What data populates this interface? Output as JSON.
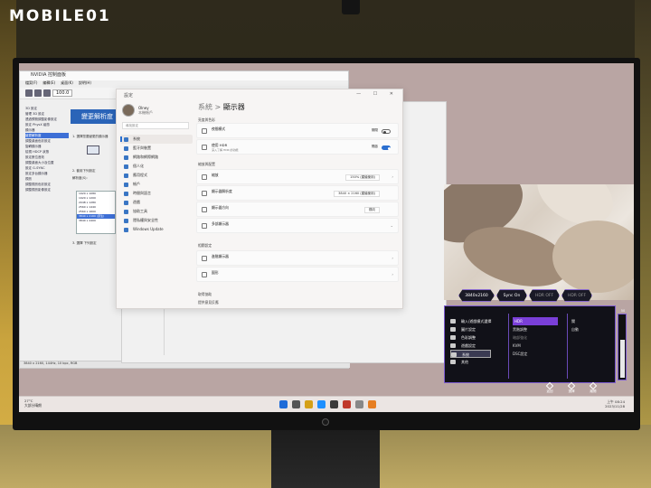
{
  "brand": {
    "text": "MOBILE01"
  },
  "old_window": {
    "title": "NVIDIA 控制面板",
    "menus": [
      "檔案(F)",
      "編輯(E)",
      "桌面(K)",
      "說明(H)"
    ],
    "zoom": "100.0",
    "panel_title": "變更解析度",
    "tree_items": [
      "3D 設定",
      "管理 3D 設定",
      "透過預覽調整影像設定",
      "設定 PhysX 組態",
      "顯示器",
      "變更解析度",
      "調整桌面色彩設定",
      "旋轉顯示器",
      "檢視 HDCP 狀態",
      "設定數位音效",
      "調整桌面大小及位置",
      "設定 G-SYNC",
      "設定多台顯示器",
      "視訊",
      "調整視訊色彩設定",
      "調整視訊影像設定"
    ],
    "selected_tree_index": 5,
    "step1": "1. 選擇您要變更的顯示器",
    "step2": "2. 套用下列設定",
    "res_label": "解析度(S):",
    "resolutions": [
      "1920 x 1080",
      "1920 x 1200",
      "2048 x 1280",
      "2560 x 1440",
      "2560 x 1600",
      "3840 x 2160 (原生)",
      "3840 x 2400"
    ],
    "selected_res_index": 5,
    "step3": "3. 選擇 下列設定",
    "status": "3840 x 2160, 144Hz, 10 bpc, RGB"
  },
  "settings": {
    "title": "設定",
    "user_name": "Olney",
    "user_sub": "本機帳戶",
    "search_placeholder": "尋找設定",
    "nav": [
      "系統",
      "藍牙與裝置",
      "網路和網際網路",
      "個人化",
      "應用程式",
      "帳戶",
      "時間與語言",
      "遊戲",
      "協助工具",
      "隱私權與安全性",
      "Windows Update"
    ],
    "active_nav_index": 0,
    "breadcrumb_parent": "系統",
    "breadcrumb_sep": ">",
    "breadcrumb_current": "顯示器",
    "section_brightness": "亮度與色彩",
    "row_night": "夜間模式",
    "row_night_state": "關閉",
    "row_hdr": "使用 HDR",
    "row_hdr_sub": "深入了解 HDR 的功能",
    "row_hdr_state": "開啟",
    "section_scale": "縮放與配置",
    "row_scale": "縮放",
    "row_scale_value": "150% (建議使用)",
    "row_resolution": "顯示器解析度",
    "row_resolution_value": "3840 × 2160 (建議使用)",
    "row_orientation": "顯示器方向",
    "row_orientation_value": "橫向",
    "row_multi": "多部顯示器",
    "section_related": "相關設定",
    "row_advanced": "進階顯示器",
    "row_graphics": "圖形",
    "footer_help": "取得協助",
    "footer_feedback": "提供意見反應"
  },
  "osd": {
    "tabs": [
      "3840x2160",
      "Sync On",
      "HDR OFF",
      "HDR OFF"
    ],
    "menu": [
      "輸入/遊戲模式選擇",
      "圖片設定",
      "色彩調整",
      "遊戲設定",
      "系統",
      "其他"
    ],
    "selected_menu_index": 4,
    "col2": [
      "HDR",
      "黑階調整",
      "暗部強化",
      "KVM",
      "DSC設定"
    ],
    "col2_highlight_index": 0,
    "col3": [
      "關",
      "自動"
    ],
    "slider_label": "50",
    "slider_level_percent": 60,
    "buttons": [
      "返回",
      "選擇",
      "離開"
    ]
  },
  "taskbar": {
    "weather_temp": "27°C",
    "weather_desc": "大部分晴朗",
    "time": "上午 08:24",
    "date": "2023/11/28",
    "icon_colors": [
      "#1e6bd8",
      "#555",
      "#d4a017",
      "#1e90ff",
      "#3a3a3a",
      "#c0392b",
      "#888",
      "#e67e22"
    ]
  }
}
